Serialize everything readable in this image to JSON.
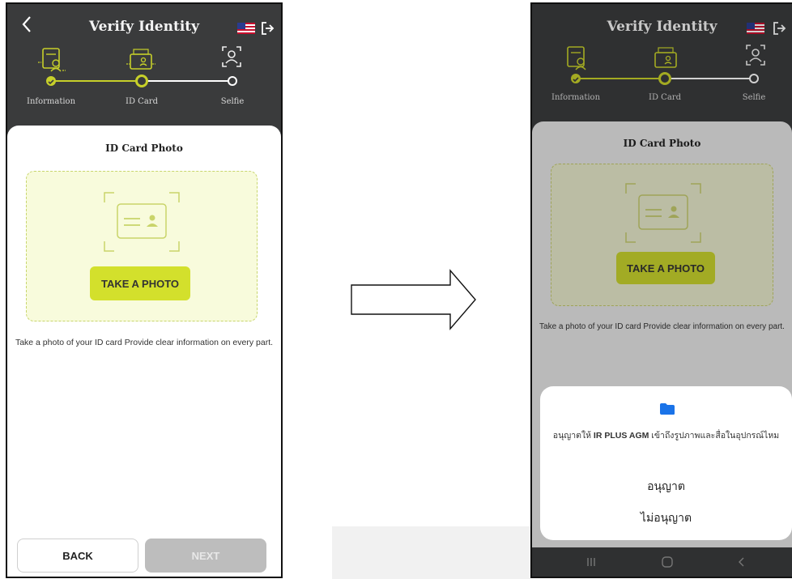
{
  "header": {
    "title": "Verify Identity"
  },
  "steps": [
    {
      "label": "Information",
      "state": "done"
    },
    {
      "label": "ID Card",
      "state": "current"
    },
    {
      "label": "Selfie",
      "state": "pending"
    }
  ],
  "card": {
    "title": "ID Card Photo",
    "take_photo_label": "TAKE A PHOTO",
    "description": "Take a photo of your ID card Provide clear information on every part."
  },
  "footer": {
    "back_label": "BACK",
    "next_label": "NEXT"
  },
  "permission_dialog": {
    "message_prefix": "อนุญาตให้ ",
    "app_name": "IR PLUS AGM",
    "message_suffix": " เข้าถึงรูปภาพและสื่อในอุปกรณ์ไหม",
    "allow_label": "อนุญาต",
    "deny_label": "ไม่อนุญาต"
  },
  "colors": {
    "accent": "#d3e02c",
    "header_bg": "#3a3b3c",
    "track_active": "#c7d02a",
    "disabled_button": "#bdbdbd",
    "folder_icon": "#1a73e8"
  },
  "icons": {
    "back": "chevron-left-icon",
    "flag": "us-flag-icon",
    "logout": "logout-icon",
    "step_information": "information-form-icon",
    "step_id_card": "id-card-icon",
    "step_selfie": "selfie-face-scan-icon",
    "permission": "folder-icon",
    "transition": "right-arrow-icon"
  }
}
